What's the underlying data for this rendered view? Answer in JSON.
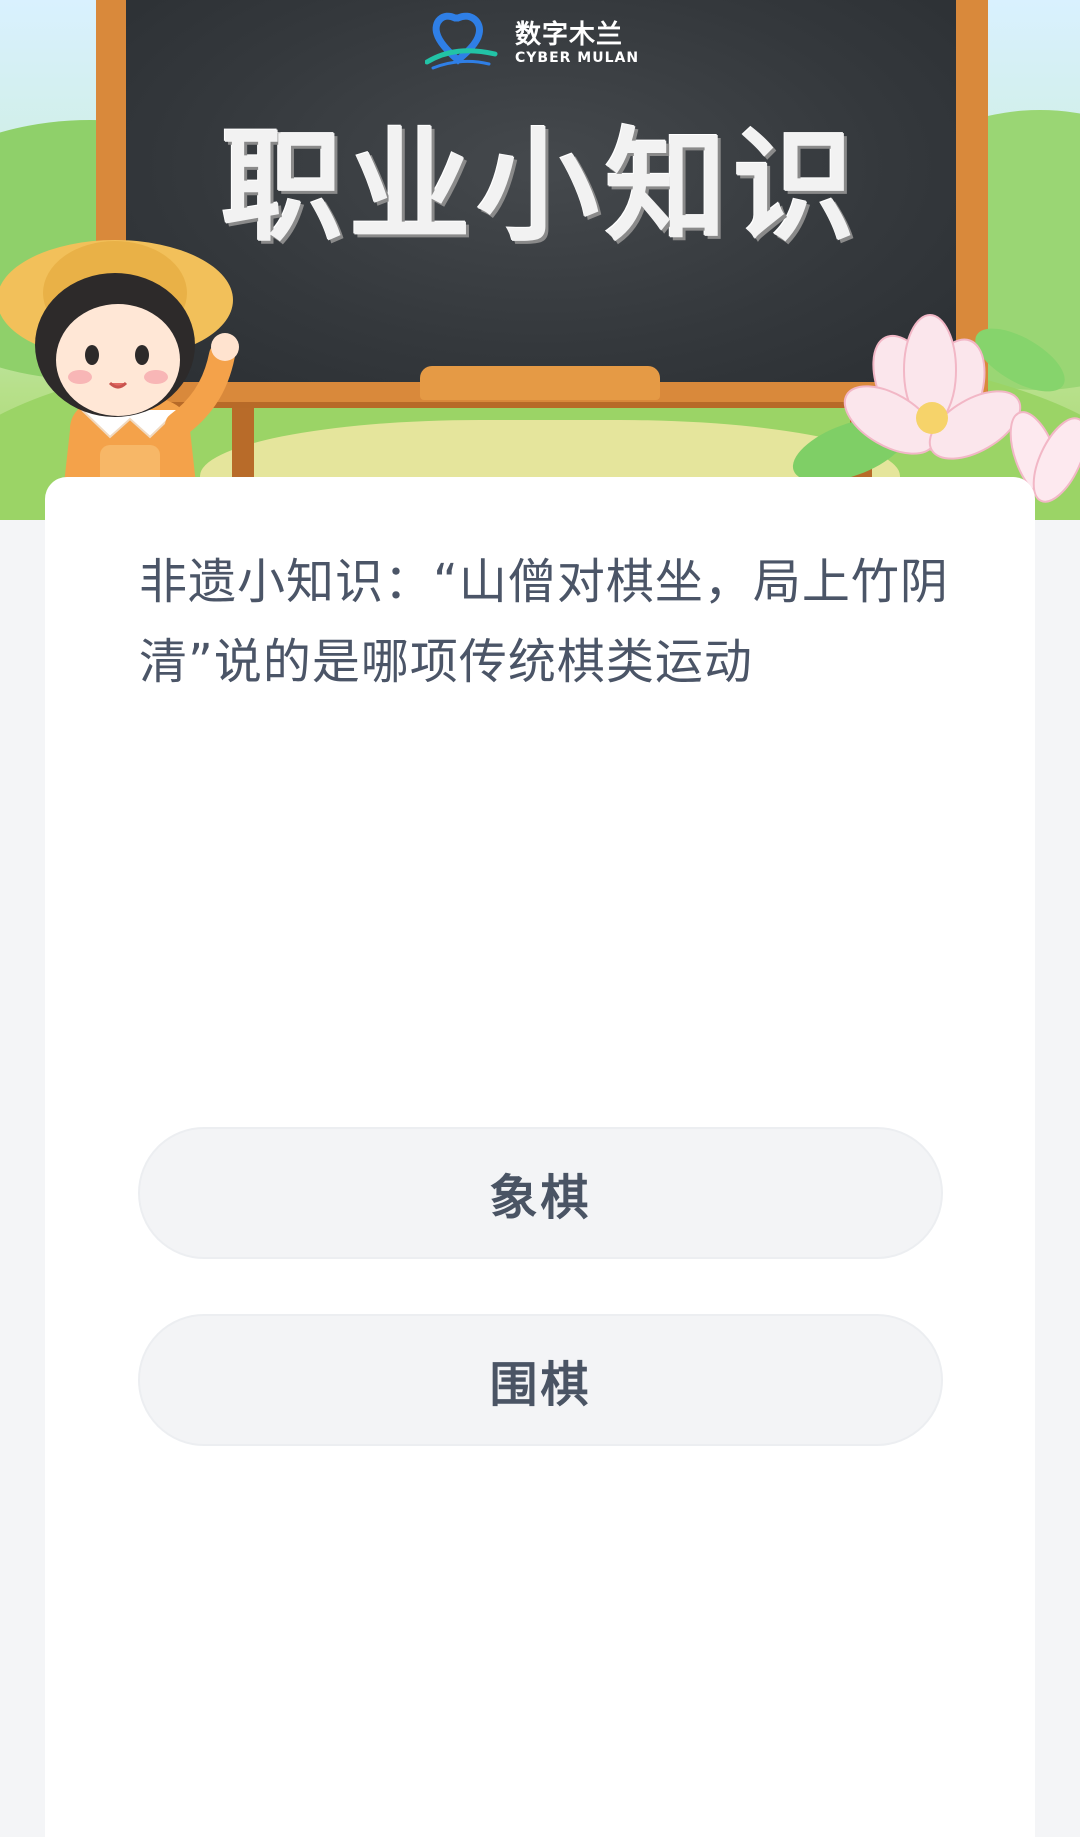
{
  "banner": {
    "brand_name": "数字木兰",
    "brand_sub": "CYBER MULAN",
    "title": "职业小知识"
  },
  "quiz": {
    "question": "非遗小知识：“山僧对棋坐，局上竹阴清”说的是哪项传统棋类运动",
    "options": [
      {
        "label": "象棋"
      },
      {
        "label": "围棋"
      }
    ]
  },
  "colors": {
    "page_background": "#f4f5f7",
    "card_background": "#ffffff",
    "question_text": "#4b5567",
    "option_background": "#f3f4f6",
    "option_text": "#4a5464",
    "chalkboard": "#3a3e42",
    "board_frame": "#d9893b",
    "logo_blue": "#2f7fe6",
    "logo_teal": "#22c3a6"
  },
  "icons": {
    "brand_logo": "heart-shield-logo",
    "mascot": "girl-with-straw-hat-illustration",
    "flowers": "magnolia-flowers-illustration"
  }
}
